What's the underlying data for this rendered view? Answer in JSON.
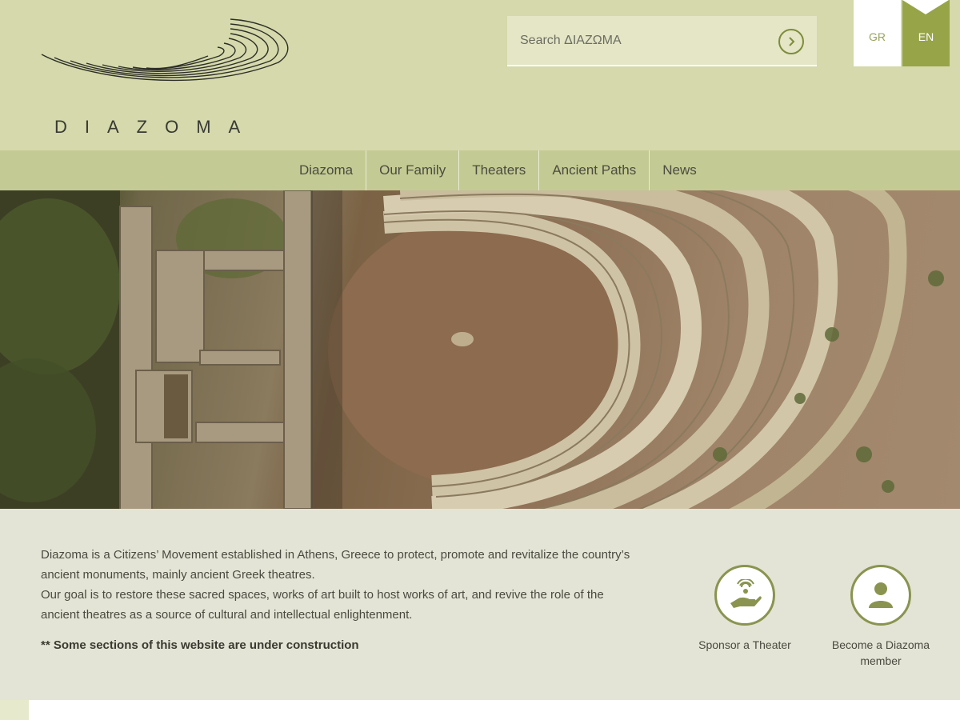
{
  "logo": {
    "text": "DIAZOMA"
  },
  "search": {
    "placeholder": "Search ΔΙΑΖΩΜΑ"
  },
  "languages": {
    "gr": "GR",
    "en": "EN",
    "active": "EN"
  },
  "nav": {
    "items": [
      {
        "label": "Diazoma"
      },
      {
        "label": "Our Family"
      },
      {
        "label": "Theaters"
      },
      {
        "label": "Ancient Paths"
      },
      {
        "label": "News"
      }
    ]
  },
  "hero": {
    "icon": "aerial-theatre-photo"
  },
  "intro": {
    "paragraph1": "Diazoma is a Citizens’ Movement established in Athens, Greece to protect, promote and revitalize the country’s ancient monuments, mainly ancient Greek theatres.",
    "paragraph2": "Our goal is to restore these sacred spaces, works of art built to host works of art, and revive the role of the ancient theatres as a source of cultural and intellectual enlightenment.",
    "notice": "** Some sections of this website are under construction"
  },
  "ctas": {
    "sponsor": {
      "label": "Sponsor a Theater",
      "icon": "hand-giving-icon"
    },
    "member": {
      "label": "Become a Diazoma member",
      "icon": "person-icon"
    }
  },
  "colors": {
    "header_bg": "#d5d9ab",
    "nav_bg": "#c4ca93",
    "accent": "#97a448",
    "info_bg": "#e3e4d5"
  }
}
